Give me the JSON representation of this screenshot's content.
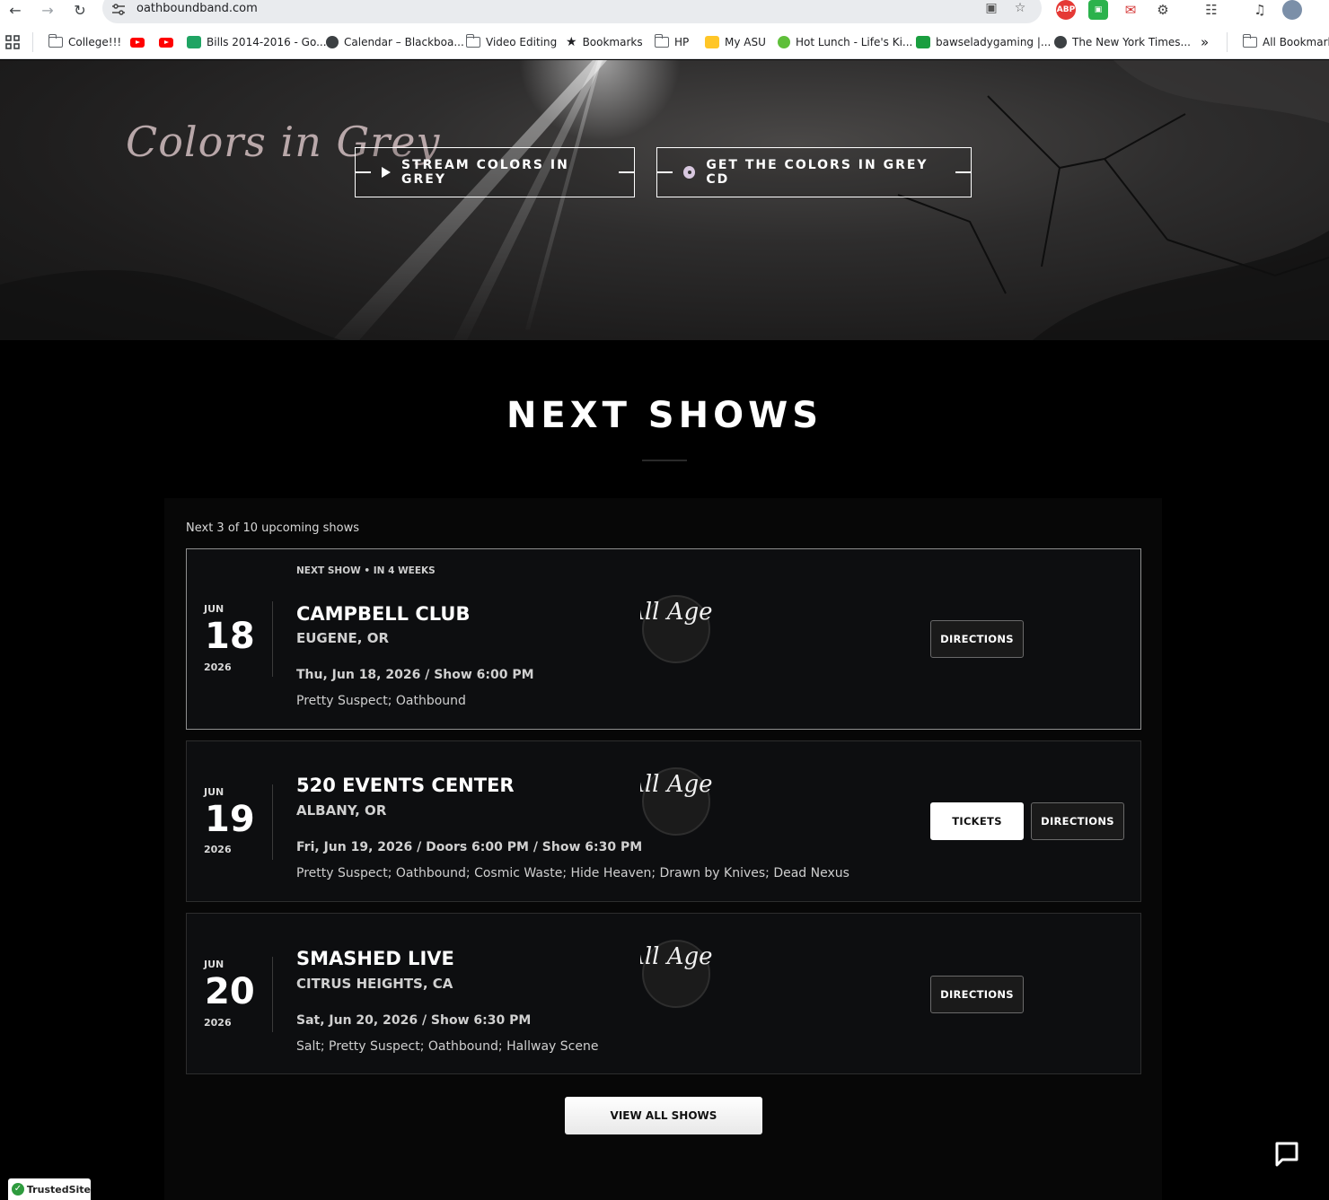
{
  "browser": {
    "url": "oathboundband.com",
    "bookmarks": [
      {
        "label": "College!!!",
        "icon": "folder-icon"
      },
      {
        "label": "",
        "icon": "youtube-icon"
      },
      {
        "label": "",
        "icon": "youtube-icon"
      },
      {
        "label": "Bills 2014-2016 - Go...",
        "icon": "sheets-icon"
      },
      {
        "label": "Calendar – Blackboa...",
        "icon": "globe-icon"
      },
      {
        "label": "Video Editing",
        "icon": "folder-icon"
      },
      {
        "label": "Bookmarks",
        "icon": "star-icon"
      },
      {
        "label": "HP",
        "icon": "folder-icon"
      },
      {
        "label": "My ASU",
        "icon": "asu-icon"
      },
      {
        "label": "Hot Lunch - Life's Ki...",
        "icon": "apple-icon"
      },
      {
        "label": "bawseladygaming |...",
        "icon": "gaming-icon"
      },
      {
        "label": "The New York Times...",
        "icon": "globe-icon"
      },
      {
        "label": "All Bookmarks",
        "icon": "folder-icon"
      }
    ],
    "overflow_label": "»"
  },
  "hero": {
    "album_title": "Colors in Grey",
    "stream_label": "STREAM COLORS IN GREY",
    "cd_label": "GET THE COLORS IN GREY CD"
  },
  "shows_section": {
    "title": "NEXT SHOWS",
    "count_text": "Next 3 of 10 upcoming shows",
    "view_all_label": "VIEW ALL SHOWS",
    "shows": [
      {
        "badge": "NEXT SHOW • IN 4 WEEKS",
        "month": "JUN",
        "day": "18",
        "year": "2026",
        "venue": "CAMPBELL CLUB",
        "city": "EUGENE, OR",
        "when": "Thu, Jun 18, 2026 / Show 6:00 PM",
        "lineup": "Pretty Suspect; Oathbound",
        "age_badge": "All Ages",
        "directions_label": "DIRECTIONS"
      },
      {
        "month": "JUN",
        "day": "19",
        "year": "2026",
        "venue": "520 EVENTS CENTER",
        "city": "ALBANY, OR",
        "when": "Fri, Jun 19, 2026 / Doors 6:00 PM / Show 6:30 PM",
        "lineup": "Pretty Suspect; Oathbound; Cosmic Waste; Hide Heaven; Drawn by Knives; Dead Nexus",
        "age_badge": "All Ages",
        "tickets_label": "TICKETS",
        "directions_label": "DIRECTIONS"
      },
      {
        "month": "JUN",
        "day": "20",
        "year": "2026",
        "venue": "SMASHED LIVE",
        "city": "CITRUS HEIGHTS, CA",
        "when": "Sat, Jun 20, 2026 / Show 6:30 PM",
        "lineup": "Salt; Pretty Suspect; Oathbound; Hallway Scene",
        "age_badge": "All Ages",
        "directions_label": "DIRECTIONS"
      }
    ]
  },
  "trust_badge": "TrustedSite"
}
